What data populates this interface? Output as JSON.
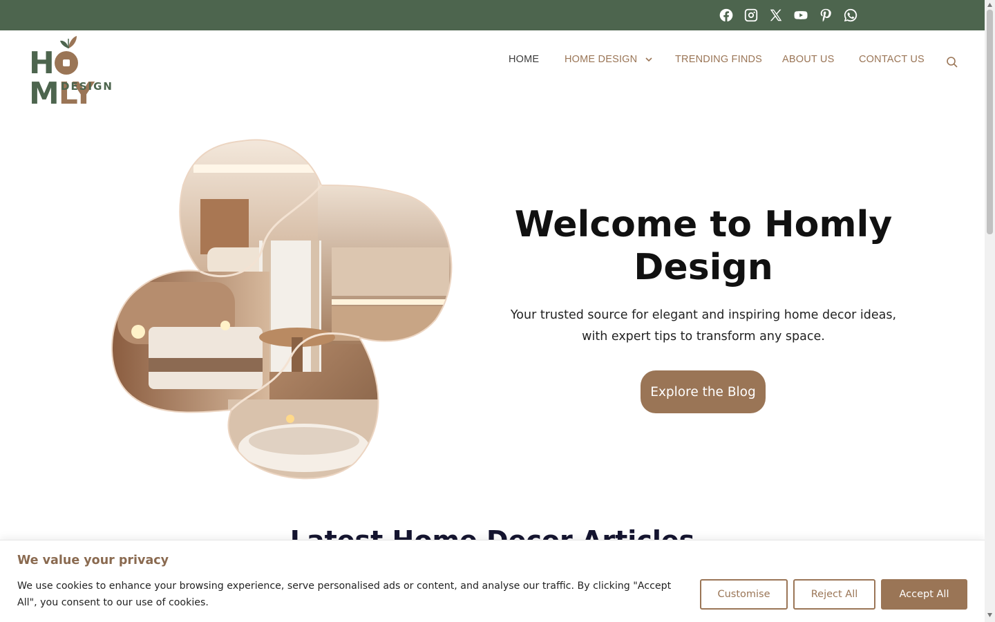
{
  "topbar": {
    "social": [
      {
        "name": "facebook-icon"
      },
      {
        "name": "instagram-icon"
      },
      {
        "name": "x-icon"
      },
      {
        "name": "youtube-icon"
      },
      {
        "name": "pinterest-icon"
      },
      {
        "name": "whatsapp-icon"
      }
    ]
  },
  "logo": {
    "word_start": "H",
    "word_mid": "M",
    "word_end": "LY",
    "sub": "DESIGN"
  },
  "nav": {
    "home": "HOME",
    "home_design": "HOME DESIGN",
    "trending": "TRENDING FINDS",
    "about": "ABOUT US",
    "contact": "CONTACT US"
  },
  "hero": {
    "title": "Welcome to Homly Design",
    "subtitle": "Your trusted source for elegant and inspiring home decor ideas, with expert tips to transform any space.",
    "button": "Explore the Blog"
  },
  "section": {
    "title": "Latest Home Decor Articles"
  },
  "cookie": {
    "title": "We value your privacy",
    "text": "We use cookies to enhance your browsing experience, serve personalised ads or content, and analyse our traffic. By clicking \"Accept All\", you consent to our use of cookies.",
    "customise": "Customise",
    "reject": "Reject All",
    "accept": "Accept All"
  },
  "colors": {
    "brand_green": "#4d654e",
    "brand_brown": "#9a7556"
  }
}
